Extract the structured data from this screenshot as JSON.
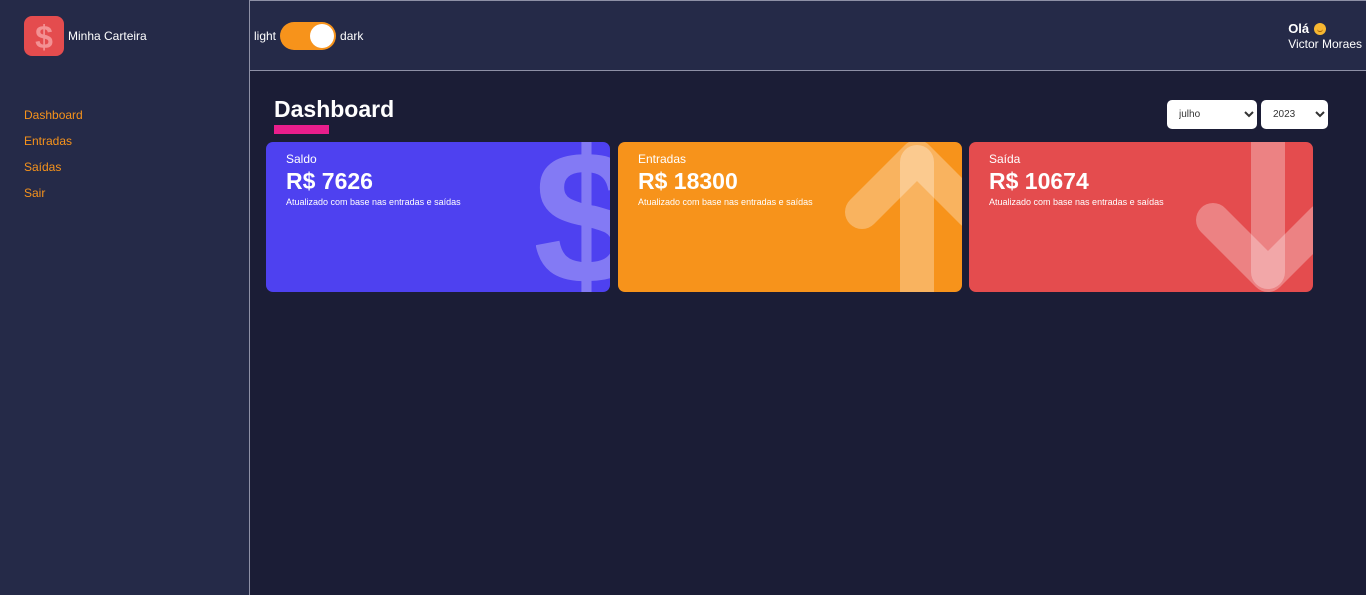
{
  "brand": {
    "name": "Minha Carteira"
  },
  "menu": {
    "items": [
      {
        "label": "Dashboard"
      },
      {
        "label": "Entradas"
      },
      {
        "label": "Saídas"
      },
      {
        "label": "Sair"
      }
    ]
  },
  "header": {
    "theme_light_label": "light",
    "theme_dark_label": "dark",
    "theme": "dark",
    "greeting": "Olá",
    "user_name": "Victor Moraes"
  },
  "main": {
    "title": "Dashboard",
    "filters": {
      "month": "julho",
      "year": "2023"
    },
    "cards": [
      {
        "label": "Saldo",
        "amount": "R$ 7626",
        "description": "Atualizado com base nas entradas e saídas",
        "icon": "dollar-icon",
        "color": "#4e41f0"
      },
      {
        "label": "Entradas",
        "amount": "R$ 18300",
        "description": "Atualizado com base nas entradas e saídas",
        "icon": "arrow-up-icon",
        "color": "#f7931b"
      },
      {
        "label": "Saída",
        "amount": "R$ 10674",
        "description": "Atualizado com base nas entradas e saídas",
        "icon": "arrow-down-icon",
        "color": "#e44c4e"
      }
    ]
  },
  "colors": {
    "sidebar": "#252a48",
    "background": "#1b1d36",
    "accent": "#f7931b",
    "title_underline": "#e91e8c"
  }
}
